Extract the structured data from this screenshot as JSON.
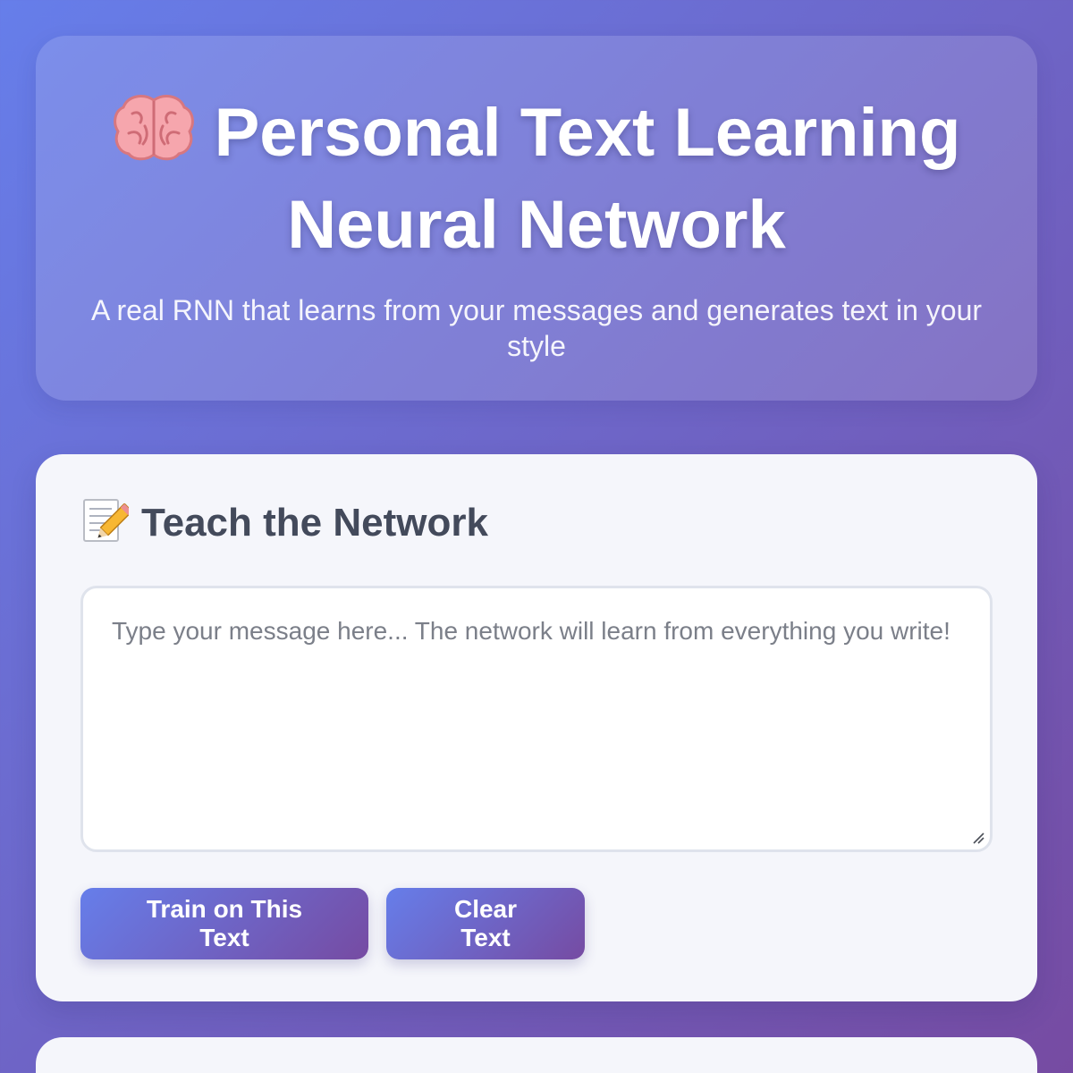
{
  "header": {
    "title": "Personal Text Learning Neural Network",
    "subtitle": "A real RNN that learns from your messages and generates text in your style",
    "icon": "brain-icon"
  },
  "teach_card": {
    "title": "Teach the Network",
    "icon": "memo-icon",
    "textarea_value": "",
    "textarea_placeholder": "Type your message here... The network will learn from everything you write!",
    "train_button": "Train on This Text",
    "clear_button": "Clear Text"
  },
  "colors": {
    "gradient_start": "#667eea",
    "gradient_end": "#764ba2",
    "card_background": "#f5f6fb",
    "heading_text": "#434a5b"
  }
}
